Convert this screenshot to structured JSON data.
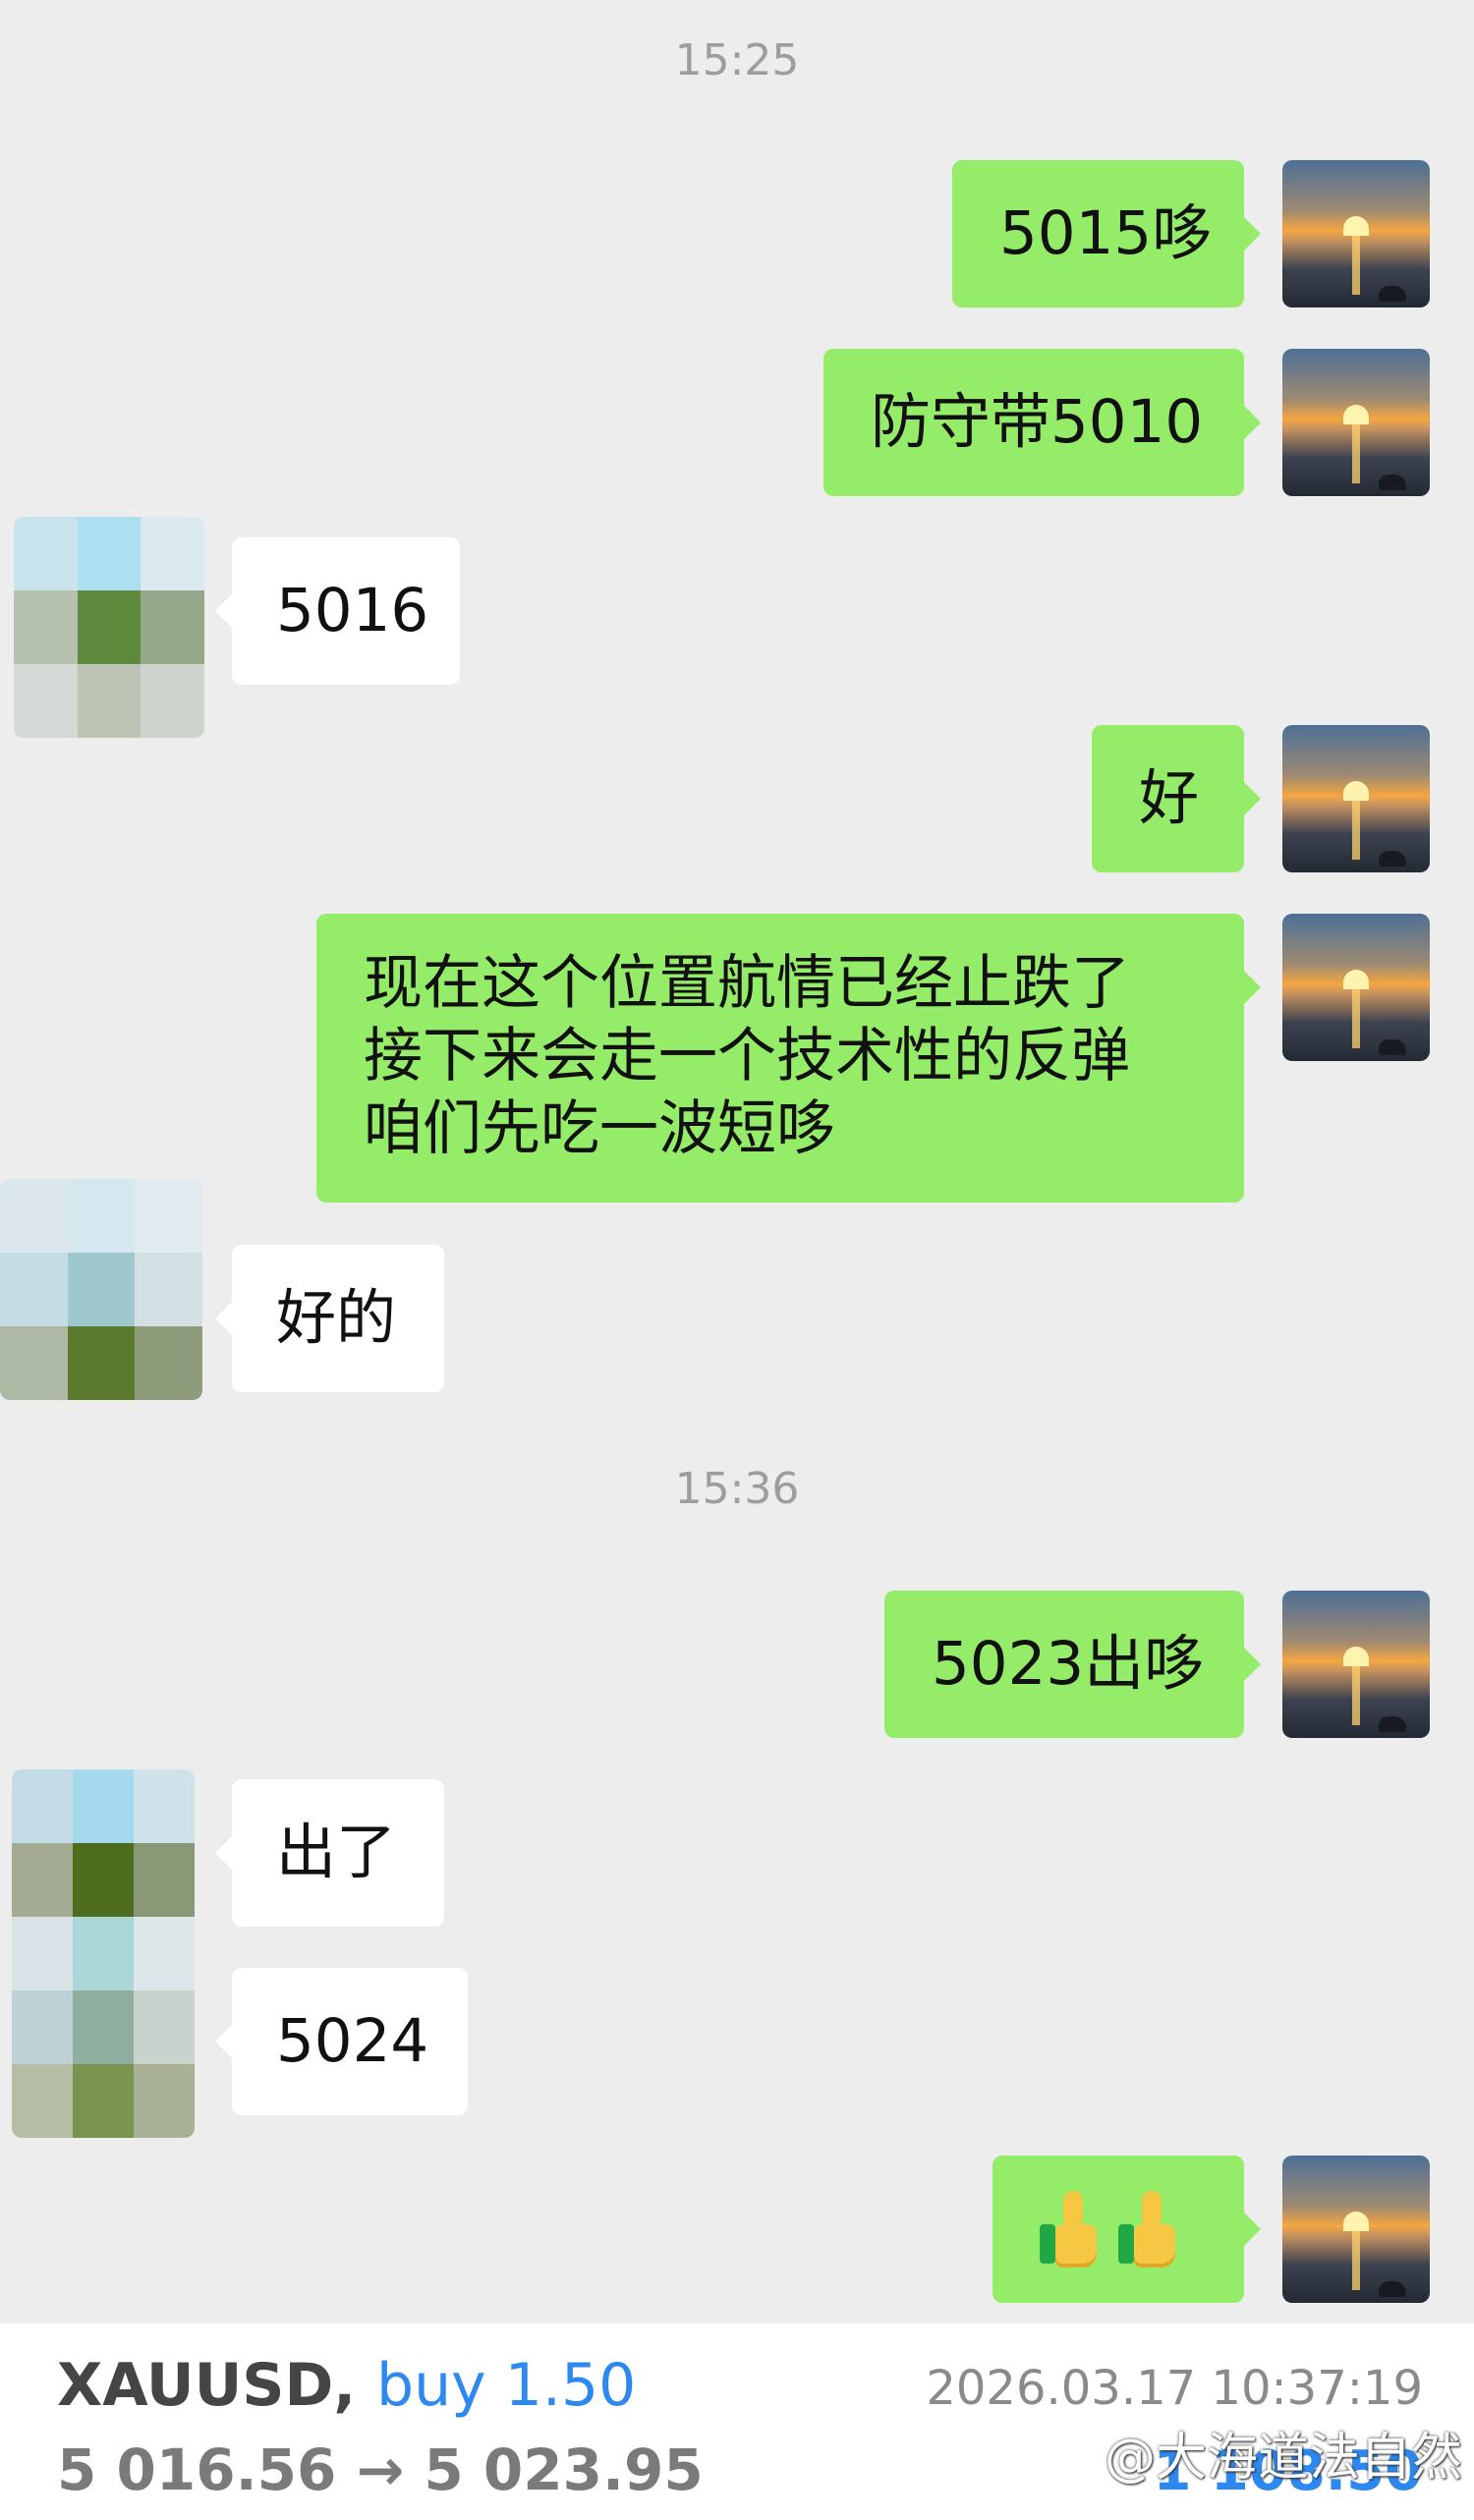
{
  "chat": {
    "time_1": "15:25",
    "time_2": "15:36",
    "messages": [
      {
        "side": "right",
        "text": "5015哆"
      },
      {
        "side": "right",
        "text": "防守带5010"
      },
      {
        "side": "left",
        "text": "5016"
      },
      {
        "side": "right",
        "text": "好"
      },
      {
        "side": "right",
        "lines": [
          "现在这个位置航情已经止跌了",
          "接下来会走一个技术性的反弹",
          "咱们先吃一波短哆"
        ]
      },
      {
        "side": "left",
        "text": "好的"
      },
      {
        "side": "right",
        "text": "5023出哆"
      },
      {
        "side": "left",
        "text": "出了"
      },
      {
        "side": "left",
        "text": "5024"
      },
      {
        "side": "right",
        "emoji": [
          "thumbs-up-icon",
          "thumbs-up-icon"
        ]
      }
    ]
  },
  "trade": {
    "symbol": "XAUUSD,",
    "side": "buy 1.50",
    "prices": "5 016.56 → 5 023.95",
    "timestamp": "2026.03.17 10:37:19",
    "profit": "1 108.50",
    "watermark": "@大海道法自然"
  },
  "colors": {
    "background": "#ededed",
    "sent_bubble": "#95ec69",
    "received_bubble": "#ffffff",
    "time_text": "#9d9d9d",
    "accent_blue": "#2d89f0"
  }
}
